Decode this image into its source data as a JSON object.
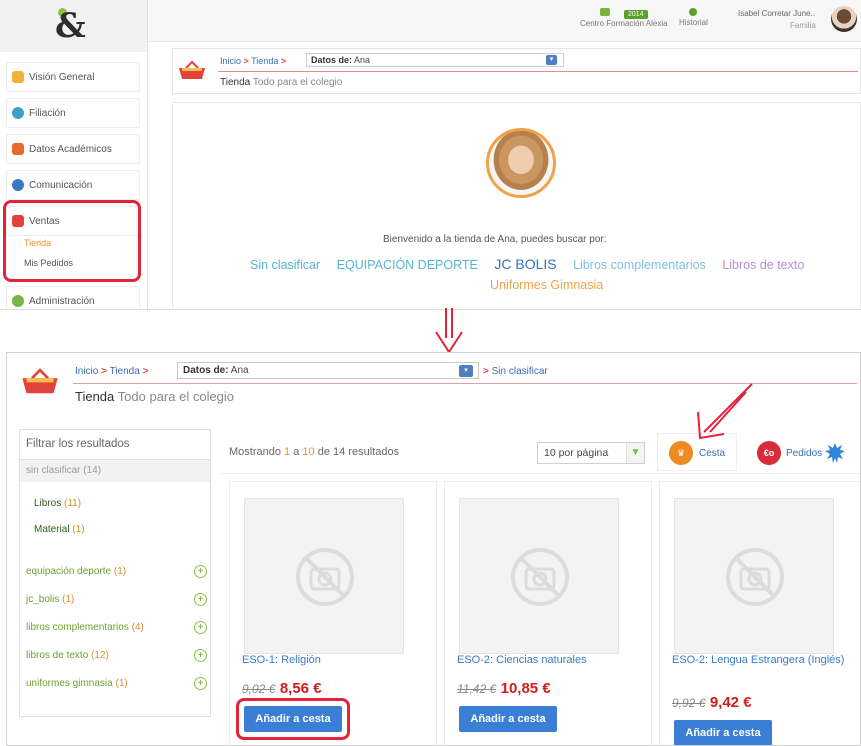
{
  "colors": {
    "accent_red": "#e2233a",
    "link_blue": "#3a7cc2",
    "green": "#6aa22e",
    "orange": "#e8942e",
    "price_red": "#d21c1c",
    "button_blue": "#3a7fd5"
  },
  "top": {
    "header": {
      "logo": "&",
      "centro_badge": "2014",
      "centro": "Centro Formación Alexia",
      "historial": "Historial",
      "user_name": "Isabel Corretar June..",
      "user_role": "Familia"
    },
    "sidebar": {
      "items": [
        {
          "label": "Visión General",
          "icon": "home-icon"
        },
        {
          "label": "Filiación",
          "icon": "profile-icon"
        },
        {
          "label": "Datos Académicos",
          "icon": "graduation-cap-icon"
        },
        {
          "label": "Comunicación",
          "icon": "chat-bubbles-icon"
        },
        {
          "label": "Ventas",
          "icon": "basket-icon"
        },
        {
          "label": "Administración",
          "icon": "gear-icon"
        }
      ],
      "subitems": [
        {
          "label": "Tienda"
        },
        {
          "label": "Mis Pedidos"
        }
      ]
    },
    "breadcrumb": {
      "inicio": "Inicio",
      "tienda": "Tienda",
      "datos_label": "Datos de:",
      "datos_value": "Ana"
    },
    "page": {
      "title": "Tienda",
      "subtitle": "Todo para el colegio"
    },
    "welcome": "Bienvenido a la tienda de Ana, puedes buscar por:",
    "categories": [
      {
        "label": "Sin clasificar",
        "color": "#55b4d8"
      },
      {
        "label": "EQUIPACIÓN DEPORTE",
        "color": "#55b4d8"
      },
      {
        "label": "JC BOLIS",
        "color": "#2f74c0"
      },
      {
        "label": "Libros complementarios",
        "color": "#7fbfe0"
      },
      {
        "label": "Libros de texto",
        "color": "#b48fd3"
      },
      {
        "label": "Uniformes Gimnasia",
        "color": "#f0a24a"
      }
    ]
  },
  "bottom": {
    "breadcrumb": {
      "inicio": "Inicio",
      "tienda": "Tienda",
      "datos_label": "Datos de:",
      "datos_value": "Ana",
      "current": "Sin clasificar"
    },
    "page": {
      "title": "Tienda",
      "subtitle": "Todo para el colegio"
    },
    "filter": {
      "header": "Filtrar los resultados",
      "sin_clasificar": "sin clasificar (14)",
      "subs": [
        {
          "label": "Libros",
          "count": "(11)"
        },
        {
          "label": "Material",
          "count": "(1)"
        }
      ],
      "categories": [
        {
          "label": "equipación deporte",
          "count": "(1)"
        },
        {
          "label": "jc_bolis",
          "count": "(1)"
        },
        {
          "label": "libros complementarios",
          "count": "(4)"
        },
        {
          "label": "libros de texto",
          "count": "(12)"
        },
        {
          "label": "uniformes gimnasia",
          "count": "(1)"
        }
      ],
      "plus_glyph": "+"
    },
    "results": {
      "prefix": "Mostrando",
      "from": "1",
      "a": "a",
      "to": "10",
      "de": "de",
      "total": "14",
      "suffix": "resultados",
      "per_page": "10 por página"
    },
    "actions": {
      "cesta": "Cesta",
      "pedidos": "Pedidos",
      "pedidos_glyph": "€o"
    },
    "products": [
      {
        "title": "ESO-1: Religión",
        "old_price": "9,02 €",
        "new_price": "8,56 €",
        "button": "Añadir a cesta"
      },
      {
        "title": "ESO-2: Ciencias naturales",
        "old_price": "11,42 €",
        "new_price": "10,85 €",
        "button": "Añadir a cesta"
      },
      {
        "title": "ESO-2: Lengua Estrangera (Inglés)",
        "old_price": "9,92 €",
        "new_price": "9,42 €",
        "button": "Añadir a cesta"
      }
    ]
  }
}
